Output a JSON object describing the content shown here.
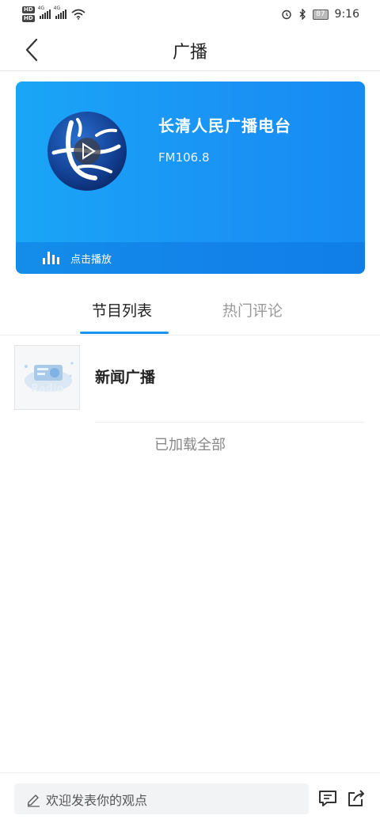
{
  "status_bar": {
    "hd1": "HD",
    "hd2": "HD",
    "net1": "4G",
    "net2": "4G",
    "battery": "87",
    "time": "9:16"
  },
  "nav": {
    "title": "广播",
    "back_icon": "chevron-left-icon"
  },
  "station": {
    "name": "长清人民广播电台",
    "frequency": "FM106.8",
    "play_label": "点击播放",
    "card_color": "#1a94f5"
  },
  "tabs": {
    "programs": "节目列表",
    "comments": "热门评论",
    "active": "programs",
    "accent": "#1a94f5"
  },
  "programs": [
    {
      "title": "新闻广播",
      "thumb_text": "Radio"
    }
  ],
  "list_footer": "已加载全部",
  "bottom_bar": {
    "comment_placeholder": "欢迎发表你的观点",
    "comment_icon": "message-icon",
    "share_icon": "share-icon"
  }
}
